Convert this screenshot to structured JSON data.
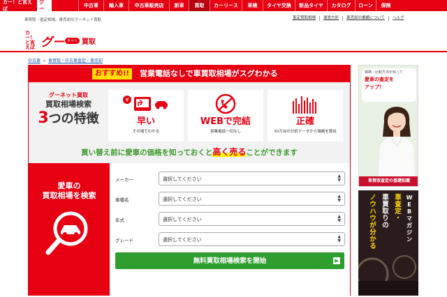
{
  "topnav": {
    "logo_text": "カー！と言えば",
    "logo_badge": "グー",
    "items": [
      {
        "label": "中古車"
      },
      {
        "label": "輸入車"
      },
      {
        "label": "中古車販売店"
      },
      {
        "label": "新車"
      },
      {
        "label": "買取"
      },
      {
        "label": "カーリース"
      },
      {
        "label": "車検"
      },
      {
        "label": "タイヤ交換"
      },
      {
        "label": "新品タイヤ"
      },
      {
        "label": "カタログ"
      },
      {
        "label": "ローン"
      },
      {
        "label": "保険"
      }
    ],
    "active": "買取"
  },
  "subbar": {
    "description": "車買取・査定相場、車売却のグーネット買取",
    "links": [
      "査定買取相場",
      "運営方針",
      "車売却の書類について",
      "ヘルプ"
    ]
  },
  "brand": {
    "car_text": "カー！と言えば",
    "logo": "グー",
    "net": "ネット",
    "kaitori": "買取"
  },
  "breadcrumb": {
    "items": [
      "中古車",
      "車買取・中古車査定・車売却"
    ]
  },
  "headband": {
    "badge": "おすすめ!!",
    "text": "営業電話なしで車買取相場がスグわかる"
  },
  "features": {
    "title_line1": "グーネット買取",
    "title_line2": "買取相場検索",
    "title_num": "3",
    "title_rest": "つの特徴",
    "cards": [
      {
        "icon": "fast-icon",
        "big": "早い",
        "small": "その場でわかる"
      },
      {
        "icon": "no-phone-icon",
        "big": "WEBで完結",
        "small": "営業電話一切なし"
      },
      {
        "icon": "bar-chart-icon",
        "big": "正確",
        "small": "30万台の分析データから価格を算出"
      }
    ]
  },
  "tagline": {
    "before": "買い替え前に愛車の価格を知っておくと",
    "highlight": "高く売る",
    "after": "ことができます"
  },
  "search": {
    "panel_title_line1": "愛車の",
    "panel_title_line2": "買取相場を検索",
    "fields": [
      {
        "label": "メーカー",
        "value": "選択してください"
      },
      {
        "label": "車種名",
        "value": "選択してください"
      },
      {
        "label": "年式",
        "value": "選択してください"
      },
      {
        "label": "グレード",
        "value": "選択してください"
      }
    ],
    "submit_label": "無料買取相場検索を開始"
  },
  "ads": {
    "ad1_line1": "相場・比較方法を知って",
    "ad1_line2": "愛車の査定を",
    "ad1_line3": "アップ！",
    "ad1_footer": "車買取査定の基礎知識",
    "ad2_col1": "車査定・",
    "ad2_col2": "車買取りの",
    "ad2_col3": "ノウハウが分かる",
    "ad2_col4": "WEBマガジン"
  },
  "colors": {
    "brand_red": "#e60012",
    "green": "#2e9e2e",
    "highlight_yellow": "#ffe000"
  }
}
